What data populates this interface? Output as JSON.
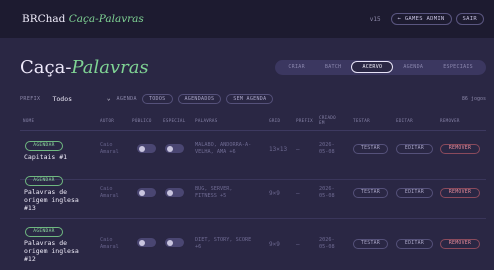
{
  "header": {
    "brand": "BRChad ",
    "brand_accent": "Caça-Palavras",
    "version": "v15",
    "games_admin": "← GAMES ADMIN",
    "logout": "SAIR"
  },
  "page": {
    "title": "Caça-",
    "title_accent": "Palavras"
  },
  "tabs": [
    {
      "label": "CRIAR",
      "active": false
    },
    {
      "label": "BATCH",
      "active": false
    },
    {
      "label": "ACERVO",
      "active": true
    },
    {
      "label": "AGENDA",
      "active": false
    },
    {
      "label": "ESPECIAIS",
      "active": false
    }
  ],
  "filters": {
    "prefix_label": "PREFIX",
    "prefix_value": "Todos",
    "agenda_label": "AGENDA",
    "pills": [
      "TODOS",
      "AGENDADOS",
      "SEM AGENDA"
    ],
    "count": "86 jogos"
  },
  "columns": {
    "nome": "NOME",
    "autor": "AUTOR",
    "publico": "PÚBLICO",
    "especial": "ESPECIAL",
    "palavras": "PALAVRAS",
    "grid": "GRID",
    "prefix": "PREFIX",
    "criado_1": "CRIADO",
    "criado_2": "EM",
    "testar": "TESTAR",
    "editar": "EDITAR",
    "remover": "REMOVER"
  },
  "rows": [
    {
      "agendar": "AGENDAR",
      "name": "Capitais #1",
      "author_1": "Caio",
      "author_2": "Amaral",
      "words_1": "MALABO, ANDORRA-A-",
      "words_2": "VELHA, AMA +6",
      "grid": "13×13",
      "prefix": "—",
      "date_1": "2026-",
      "date_2": "05-08",
      "testar": "TESTAR",
      "editar": "EDITAR",
      "remover": "REMOVER"
    },
    {
      "agendar": "AGENDAR",
      "name_1": "Palavras de",
      "name_2": "origem inglesa",
      "name_3": "#13",
      "author_1": "Caio",
      "author_2": "Amaral",
      "words_1": "BUG, SERVER,",
      "words_2": "FITNESS +5",
      "grid": "9×9",
      "prefix": "—",
      "date_1": "2026-",
      "date_2": "05-08",
      "testar": "TESTAR",
      "editar": "EDITAR",
      "remover": "REMOVER"
    },
    {
      "agendar": "AGENDAR",
      "name_1": "Palavras de",
      "name_2": "origem inglesa",
      "name_3": "#12",
      "author_1": "Caio",
      "author_2": "Amaral",
      "words_1": "DIET, STORY, SCORE",
      "words_2": "+6",
      "grid": "9×9",
      "prefix": "—",
      "date_1": "2026-",
      "date_2": "05-08",
      "testar": "TESTAR",
      "editar": "EDITAR",
      "remover": "REMOVER"
    }
  ]
}
